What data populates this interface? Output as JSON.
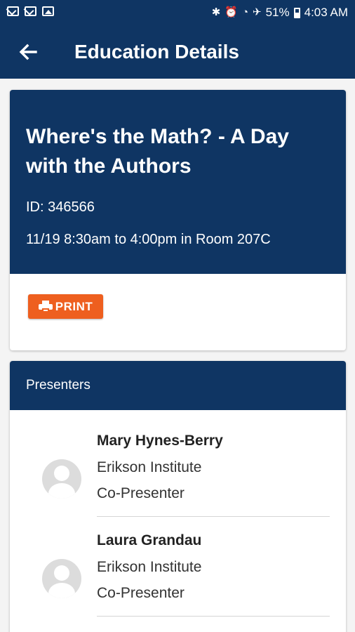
{
  "status_bar": {
    "battery": "51%",
    "time": "4:03 AM",
    "left_icons": [
      "mail-icon",
      "mail-icon",
      "image-icon"
    ],
    "right_icons": [
      "bluetooth-icon",
      "alarm-icon",
      "wifi-icon",
      "airplane-icon",
      "battery-icon"
    ]
  },
  "app_bar": {
    "title": "Education Details"
  },
  "event": {
    "title": "Where's the Math? - A Day with the Authors",
    "id_line": "ID: 346566",
    "when_line": "11/19 8:30am to 4:00pm in Room 207C",
    "print_label": "PRINT"
  },
  "presenters_section": {
    "header": "Presenters",
    "items": [
      {
        "name": "Mary Hynes-Berry",
        "organization": "Erikson Institute",
        "role": "Co-Presenter"
      },
      {
        "name": "Laura Grandau",
        "organization": "Erikson Institute",
        "role": "Co-Presenter"
      }
    ]
  },
  "colors": {
    "primary": "#0f3563",
    "accent": "#ee5f1f",
    "background": "#f4f4f4"
  }
}
